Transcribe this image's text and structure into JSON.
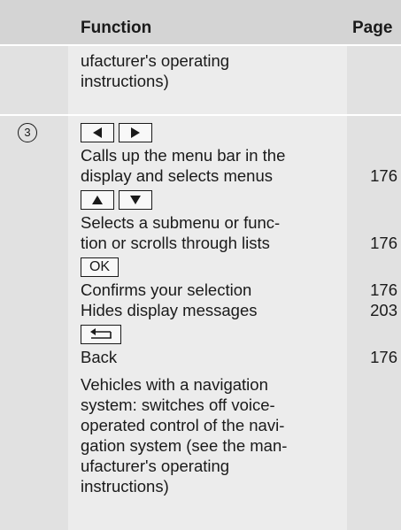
{
  "header": {
    "function_label": "Function",
    "page_label": "Page"
  },
  "row_prev": {
    "lines": [
      "ufacturer's operating",
      "instructions)"
    ]
  },
  "row_3": {
    "number": "3",
    "entries": {
      "menu_bar": {
        "lines": [
          "Calls up the menu bar in the",
          "display and selects menus"
        ],
        "page": "176"
      },
      "submenu": {
        "lines": [
          "Selects a submenu or func-",
          "tion or scrolls through lists"
        ],
        "page": "176"
      },
      "ok_key_label": "OK",
      "confirm": {
        "text": "Confirms your selection",
        "page": "176"
      },
      "hide": {
        "text": "Hides display messages",
        "page": "203"
      },
      "back": {
        "text": "Back",
        "page": "176"
      },
      "nav": {
        "lines": [
          "Vehicles with a navigation",
          "system: switches off voice-",
          "operated control of the navi-",
          "gation system (see the man-",
          "ufacturer's operating",
          "instructions)"
        ]
      }
    }
  },
  "icons": [
    "left-arrow-key-icon",
    "right-arrow-key-icon",
    "up-arrow-key-icon",
    "down-arrow-key-icon",
    "back-key-icon"
  ],
  "colors": {
    "header_bg": "#d4d4d4",
    "cell_bg": "#ececec",
    "side_bg": "#e1e1e1",
    "text": "#1a1a1a"
  }
}
